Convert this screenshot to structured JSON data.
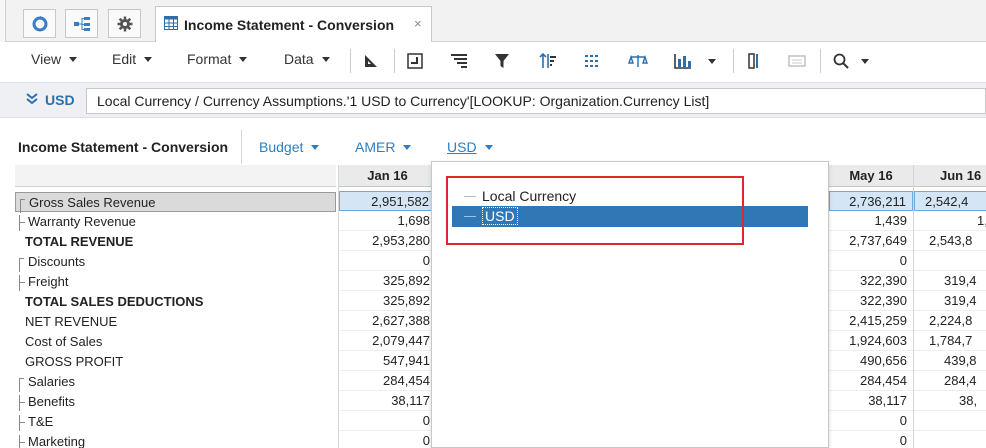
{
  "tabs": {
    "document_title": "Income Statement - Conversion",
    "close_glyph": "×"
  },
  "menus": [
    {
      "label": "View"
    },
    {
      "label": "Edit"
    },
    {
      "label": "Format"
    },
    {
      "label": "Data"
    }
  ],
  "formula_bar": {
    "label": "USD",
    "expression": "Local Currency / Currency Assumptions.'1 USD to Currency'[LOOKUP: Organization.Currency List]"
  },
  "context": {
    "title": "Income Statement - Conversion",
    "selectors": [
      {
        "label": "Budget"
      },
      {
        "label": "AMER"
      },
      {
        "label": "USD"
      }
    ]
  },
  "dropdown": {
    "options": [
      {
        "label": "Local Currency",
        "selected": false
      },
      {
        "label": "USD",
        "selected": true
      }
    ]
  },
  "grid": {
    "rows": [
      {
        "label": "Gross Sales Revenue",
        "bold": false,
        "child": true
      },
      {
        "label": "Warranty Revenue",
        "bold": false,
        "child": true
      },
      {
        "label": "TOTAL REVENUE",
        "bold": true,
        "child": false
      },
      {
        "label": "Discounts",
        "bold": false,
        "child": true
      },
      {
        "label": "Freight",
        "bold": false,
        "child": true
      },
      {
        "label": "TOTAL SALES DEDUCTIONS",
        "bold": true,
        "child": false
      },
      {
        "label": "NET REVENUE",
        "bold": false,
        "child": false
      },
      {
        "label": "Cost of Sales",
        "bold": false,
        "child": false
      },
      {
        "label": "GROSS PROFIT",
        "bold": false,
        "child": false
      },
      {
        "label": "Salaries",
        "bold": false,
        "child": true
      },
      {
        "label": "Benefits",
        "bold": false,
        "child": true
      },
      {
        "label": "T&E",
        "bold": false,
        "child": true
      },
      {
        "label": "Marketing",
        "bold": false,
        "child": true
      }
    ],
    "columns": [
      {
        "header": "Jan 16",
        "values": [
          "2,951,582",
          "1,698",
          "2,953,280",
          "0",
          "325,892",
          "325,892",
          "2,627,388",
          "2,079,447",
          "547,941",
          "284,454",
          "38,117",
          "0",
          "0"
        ]
      },
      {
        "header": "May 16",
        "values": [
          "2,736,211",
          "1,439",
          "2,737,649",
          "0",
          "322,390",
          "322,390",
          "2,415,259",
          "1,924,603",
          "490,656",
          "284,454",
          "38,117",
          "0",
          "0"
        ]
      },
      {
        "header": "Jun 16",
        "values": [
          "2,542,4",
          "1,",
          "2,543,8",
          "",
          "319,4",
          "319,4",
          "2,224,8",
          "1,784,7",
          "439,8",
          "284,4",
          "38,",
          "",
          ""
        ]
      }
    ]
  }
}
